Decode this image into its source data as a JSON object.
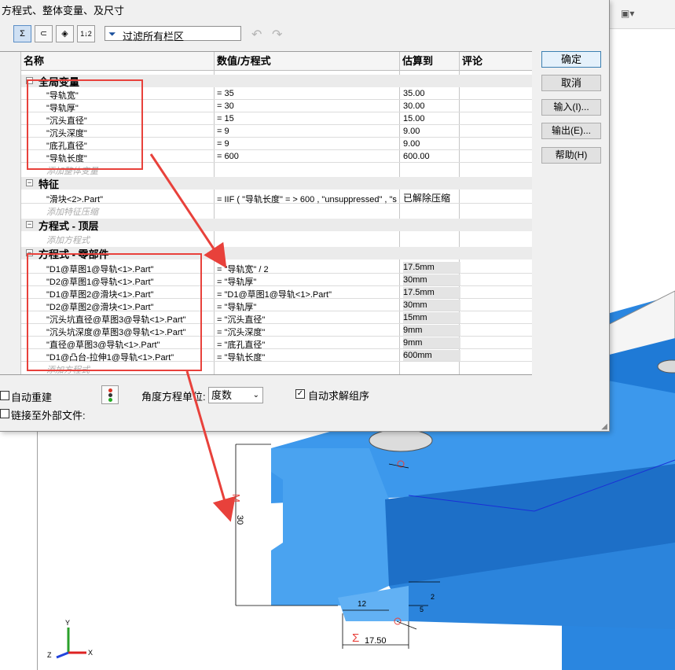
{
  "window": {
    "title": "方程式、整体变量、及尺寸"
  },
  "toolbar": {
    "buttons": [
      {
        "name": "equation-view",
        "glyph": "Σ"
      },
      {
        "name": "sketch-equation-view",
        "glyph": "⊂"
      },
      {
        "name": "dimension-view",
        "glyph": "◈"
      },
      {
        "name": "ordered-view",
        "glyph": "1↓2"
      }
    ],
    "filter_text": "过滤所有栏区"
  },
  "grid": {
    "headers": {
      "name": "名称",
      "value": "数值/方程式",
      "evaluates": "估算到",
      "comment": "评论"
    },
    "sections": [
      {
        "title": "全局变量",
        "rows": [
          {
            "name": "\"导轨宽\"",
            "value": "= 35",
            "eval": "35.00"
          },
          {
            "name": "\"导轨厚\"",
            "value": "= 30",
            "eval": "30.00"
          },
          {
            "name": "\"沉头直径\"",
            "value": "= 15",
            "eval": "15.00"
          },
          {
            "name": "\"沉头深度\"",
            "value": "= 9",
            "eval": "9.00"
          },
          {
            "name": "\"底孔直径\"",
            "value": "= 9",
            "eval": "9.00"
          },
          {
            "name": "\"导轨长度\"",
            "value": "= 600",
            "eval": "600.00"
          }
        ],
        "add_label": "添加整体变量"
      },
      {
        "title": "特征",
        "rows": [
          {
            "name": "\"滑块<2>.Part\"",
            "value": "= IIF ( \"导轨长度\" = > 600 , \"unsuppressed\" , \"s",
            "eval": "已解除压缩"
          }
        ],
        "add_label": "添加特征压缩"
      },
      {
        "title": "方程式 - 顶层",
        "rows": [],
        "add_label": "添加方程式"
      },
      {
        "title": "方程式 - 零部件",
        "rows": [
          {
            "name": "\"D1@草图1@导轨<1>.Part\"",
            "value": "= \"导轨宽\" / 2",
            "eval": "17.5mm"
          },
          {
            "name": "\"D2@草图1@导轨<1>.Part\"",
            "value": "= \"导轨厚\"",
            "eval": "30mm"
          },
          {
            "name": "\"D1@草图2@滑块<1>.Part\"",
            "value": "= \"D1@草图1@导轨<1>.Part\"",
            "eval": "17.5mm"
          },
          {
            "name": "\"D2@草图2@滑块<1>.Part\"",
            "value": "= \"导轨厚\"",
            "eval": "30mm"
          },
          {
            "name": "\"沉头坑直径@草图3@导轨<1>.Part\"",
            "value": "= \"沉头直径\"",
            "eval": "15mm"
          },
          {
            "name": "\"沉头坑深度@草图3@导轨<1>.Part\"",
            "value": "= \"沉头深度\"",
            "eval": "9mm"
          },
          {
            "name": "\"直径@草图3@导轨<1>.Part\"",
            "value": "= \"底孔直径\"",
            "eval": "9mm"
          },
          {
            "name": "\"D1@凸台-拉伸1@导轨<1>.Part\"",
            "value": "= \"导轨长度\"",
            "eval": "600mm"
          }
        ],
        "add_label": "添加方程式"
      }
    ]
  },
  "buttons": {
    "ok": "确定",
    "cancel": "取消",
    "import": "输入(I)...",
    "export": "输出(E)...",
    "help": "帮助(H)"
  },
  "options": {
    "auto_rebuild": "自动重建",
    "auto_rebuild_checked": false,
    "angle_unit_label": "角度方程单位:",
    "angle_unit_value": "度数",
    "auto_solve": "自动求解组序",
    "auto_solve_checked": true,
    "link_external": "链接至外部文件:",
    "link_external_checked": false
  },
  "cad": {
    "part_color": "#2e8be6",
    "dims": {
      "height": "30",
      "half_width": "17.50",
      "base": "12",
      "small_a": "5",
      "small_b": "2"
    },
    "dim_markers": {
      "eq": "Σ",
      "var": "M"
    },
    "triad": {
      "y": "Y",
      "x": "X",
      "z": "Z"
    }
  },
  "colors": {
    "annotation": "#e8413b",
    "accent": "#3c7fb1"
  }
}
